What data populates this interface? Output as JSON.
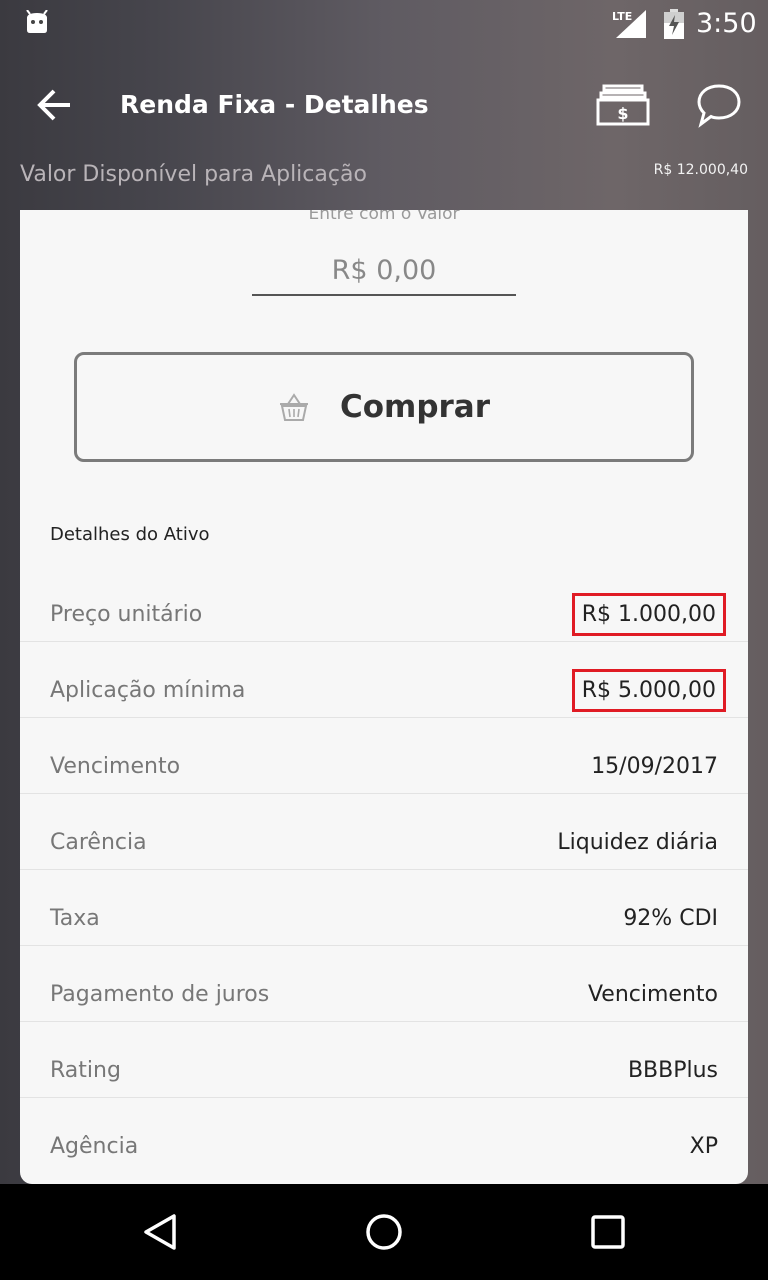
{
  "status_bar": {
    "network": "LTE",
    "time": "3:50",
    "icons": [
      "android-icon",
      "signal-icon",
      "battery-icon"
    ]
  },
  "app_bar": {
    "title": "Renda Fixa - Detalhes",
    "icons": [
      "back-arrow-icon",
      "money-bills-icon",
      "chat-bubble-icon"
    ]
  },
  "available": {
    "label": "Valor Disponível para Aplicação",
    "value": "R$ 12.000,40"
  },
  "purchase": {
    "hint": "Entre com o Valor",
    "placeholder": "R$ 0,00",
    "button_label": "Comprar",
    "button_icon": "basket-icon"
  },
  "details": {
    "title": "Detalhes do Ativo",
    "rows": [
      {
        "label": "Preço unitário",
        "value": "R$ 1.000,00"
      },
      {
        "label": "Aplicação mínima",
        "value": "R$ 5.000,00"
      },
      {
        "label": "Vencimento",
        "value": "15/09/2017"
      },
      {
        "label": "Carência",
        "value": "Liquidez diária"
      },
      {
        "label": "Taxa",
        "value": "92% CDI"
      },
      {
        "label": "Pagamento de juros",
        "value": "Vencimento"
      },
      {
        "label": "Rating",
        "value": "BBBPlus"
      },
      {
        "label": "Agência",
        "value": "XP"
      }
    ]
  },
  "colors": {
    "highlight_border": "#e01b24",
    "card_background": "#f7f7f7",
    "nav_bar": "#000000"
  },
  "nav_bar": {
    "icons": [
      "nav-back-icon",
      "nav-home-icon",
      "nav-recents-icon"
    ]
  }
}
